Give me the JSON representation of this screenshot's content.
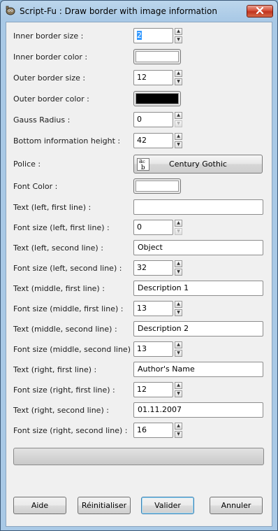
{
  "window": {
    "title": "Script-Fu : Draw border with image information"
  },
  "fields": [
    {
      "label": "Inner border size :",
      "type": "spin",
      "value": "2",
      "selected": true,
      "down_disabled": false
    },
    {
      "label": "Inner border color :",
      "type": "color",
      "color": "#ffffff"
    },
    {
      "label": "Outer border size :",
      "type": "spin",
      "value": "12",
      "down_disabled": false
    },
    {
      "label": "Outer border color :",
      "type": "color",
      "color": "#000000"
    },
    {
      "label": "Gauss Radius :",
      "type": "spin",
      "value": "0",
      "down_disabled": true
    },
    {
      "label": "Bottom information height :",
      "type": "spin",
      "value": "42",
      "down_disabled": false
    },
    {
      "label": "Police :",
      "type": "font",
      "value": "Century Gothic"
    },
    {
      "label": "Font Color :",
      "type": "color",
      "color": "#ffffff"
    },
    {
      "label": "Text (left, first line) :",
      "type": "text",
      "value": ""
    },
    {
      "label": "Font size (left, first line) :",
      "type": "spin",
      "value": "0",
      "down_disabled": true
    },
    {
      "label": "Text (left, second line) :",
      "type": "text",
      "value": "Object"
    },
    {
      "label": "Font size (left, second line) :",
      "type": "spin",
      "value": "32",
      "down_disabled": false
    },
    {
      "label": "Text (middle, first line) :",
      "type": "text",
      "value": "Description 1"
    },
    {
      "label": "Font size (middle, first line) :",
      "type": "spin",
      "value": "13",
      "down_disabled": false
    },
    {
      "label": "Text (middle, second line) :",
      "type": "text",
      "value": "Description 2"
    },
    {
      "label": "Font size (middle, second line) :",
      "type": "spin",
      "value": "13",
      "down_disabled": false
    },
    {
      "label": "Text (right, first line) :",
      "type": "text",
      "value": "Author's Name"
    },
    {
      "label": "Font size (right, first line) :",
      "type": "spin",
      "value": "12",
      "down_disabled": false
    },
    {
      "label": "Text (right, second line) :",
      "type": "text",
      "value": "01.11.2007"
    },
    {
      "label": "Font size (right, second line) :",
      "type": "spin",
      "value": "16",
      "down_disabled": false
    }
  ],
  "buttons": {
    "help": "Aide",
    "reset": "Réinitialiser",
    "ok": "Valider",
    "cancel": "Annuler"
  },
  "icons": {
    "app": "gimp-icon",
    "close": "close-icon",
    "font": "font-icon",
    "spin_up": "arrow-up-icon",
    "spin_down": "arrow-down-icon"
  }
}
